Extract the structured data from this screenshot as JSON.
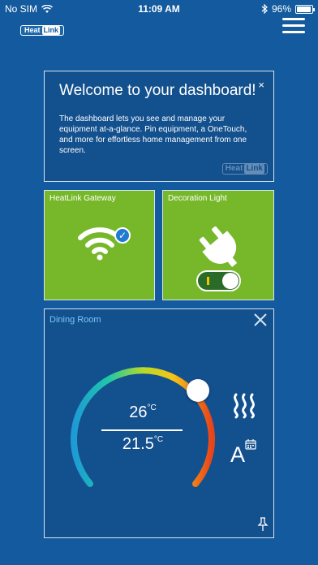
{
  "status_bar": {
    "carrier": "No SIM",
    "time": "11:09 AM",
    "battery_percent": "96%",
    "battery_level": 0.96,
    "icons": [
      "wifi-icon",
      "bluetooth-icon",
      "battery-icon"
    ]
  },
  "header": {
    "logo_part1": "Heat",
    "logo_part2": "Link",
    "menu_icon": "hamburger-menu-icon"
  },
  "welcome_card": {
    "title": "Welcome to your dashboard!",
    "close": "×",
    "body": "The dashboard lets you see and manage your equipment at-a-glance. Pin equipment, a OneTouch, and more for effortless home management from one screen.",
    "watermark_part1": "Heat",
    "watermark_part2": "Link"
  },
  "tiles": {
    "gateway": {
      "title": "HeatLink Gateway",
      "icon": "wifi-connected-icon"
    },
    "light": {
      "title": "Decoration Light",
      "icon": "plug-icon",
      "toggle_on": true
    }
  },
  "room": {
    "title": "Dining Room",
    "current_temp": "26",
    "current_unit": "°C",
    "target_temp": "21.5",
    "target_unit": "°C",
    "auto_mode_letter": "A",
    "icons": [
      "close-icon",
      "heating-icon",
      "auto-schedule-icon",
      "pin-icon"
    ]
  },
  "colors": {
    "background": "#135a9e",
    "card_background": "#13508e",
    "tile_green": "#76b82a",
    "room_title": "#79c8f2",
    "check_blue": "#1f7cd1"
  }
}
